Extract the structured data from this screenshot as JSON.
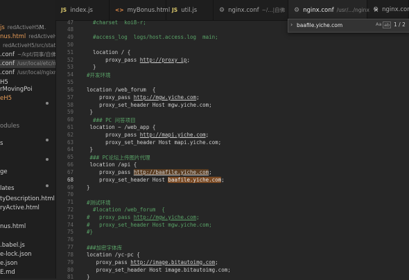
{
  "sidebar": {
    "items": [
      {
        "label": "js",
        "sub": "redActiveH5/...",
        "badge": "M",
        "style": "accent"
      },
      {
        "label": "nus.html",
        "sub": "redActiveH...",
        "style": "accent"
      },
      {
        "label": "",
        "sub": "redActiveH5/src/stati...",
        "style": ""
      },
      {
        "label": ".conf",
        "sub": "~/kpt/同事/自佛",
        "style": ""
      },
      {
        "label": ".conf",
        "sub": "/usr/local/etc/ngin",
        "style": "active"
      },
      {
        "label": ".conf",
        "sub": "/usr/local/ngixn/c...",
        "style": ""
      },
      {
        "label": "H5",
        "sub": "",
        "style": ""
      },
      {
        "label": "rMovingPoi",
        "sub": "",
        "style": ""
      },
      {
        "label": "eH5",
        "sub": "",
        "style": "accent"
      },
      {
        "label": "odules",
        "sub": "",
        "style": "section"
      },
      {
        "label": "s",
        "sub": "",
        "style": ""
      },
      {
        "label": "",
        "sub": "",
        "style": ""
      },
      {
        "label": "ge",
        "sub": "",
        "style": ""
      },
      {
        "label": "lates",
        "sub": "",
        "style": ""
      },
      {
        "label": "tyDescription.html",
        "sub": "",
        "style": ""
      },
      {
        "label": "ryActive.html",
        "sub": "",
        "style": ""
      },
      {
        "label": "",
        "sub": "",
        "style": ""
      },
      {
        "label": "nus.html",
        "sub": "",
        "style": ""
      },
      {
        "label": "",
        "sub": "",
        "style": ""
      },
      {
        "label": ".babel.js",
        "sub": "",
        "style": ""
      },
      {
        "label": "e-lock.json",
        "sub": "",
        "style": ""
      },
      {
        "label": "e.json",
        "sub": "",
        "style": ""
      },
      {
        "label": "E.md",
        "sub": "",
        "style": ""
      }
    ]
  },
  "tabs": [
    {
      "icon": "JS",
      "icon_class": "js",
      "label": "index.js",
      "dim": ""
    },
    {
      "icon": "<>",
      "icon_class": "html",
      "label": "myBonus.html",
      "dim": ""
    },
    {
      "icon": "JS",
      "icon_class": "js",
      "label": "util.js",
      "dim": ""
    },
    {
      "icon": "⚙",
      "icon_class": "gear",
      "label": "nginx.conf",
      "dim": "~/...|自佛"
    },
    {
      "icon": "⚙",
      "icon_class": "gear",
      "label": "nginx.conf",
      "dim": "/usr/.../nginx",
      "active": true
    },
    {
      "icon": "⚙",
      "icon_class": "gear",
      "label": "nginx.conf",
      "dim": ""
    }
  ],
  "find": {
    "query": "baafile.yiche.com",
    "opt_case": "Aa",
    "opt_word": "ab",
    "opt_regex": ".*",
    "count": "1 / 2"
  },
  "lines": [
    {
      "n": "47",
      "text": "    #charset  koi8-r;",
      "cls": "comment"
    },
    {
      "n": "48",
      "text": "",
      "cls": ""
    },
    {
      "n": "49",
      "text": "    #access_log  logs/host.access.log  main;",
      "cls": "comment"
    },
    {
      "n": "50",
      "text": "",
      "cls": ""
    },
    {
      "n": "51",
      "text": "    location / {",
      "cls": ""
    },
    {
      "n": "52",
      "pre": "        proxy_pass ",
      "url": "http://proxy_ip",
      "post": ";",
      "cls": ""
    },
    {
      "n": "53",
      "text": "    }",
      "cls": ""
    },
    {
      "n": "54",
      "text": "  #开发环境",
      "cls": "comment"
    },
    {
      "n": "55",
      "text": "",
      "cls": ""
    },
    {
      "n": "56",
      "text": "  location /web_forum  {",
      "cls": ""
    },
    {
      "n": "57",
      "pre": "      proxy_pass ",
      "url": "http://mgw.yiche.com",
      "post": ";",
      "cls": ""
    },
    {
      "n": "58",
      "text": "      proxy_set_header Host mgw.yiche.com;",
      "cls": ""
    },
    {
      "n": "59",
      "text": "   }",
      "cls": ""
    },
    {
      "n": "60",
      "text": "    ### PC 问答项目",
      "cls": "comment"
    },
    {
      "n": "61",
      "text": "   location ~ /web_app {",
      "cls": ""
    },
    {
      "n": "62",
      "pre": "        proxy_pass ",
      "url": "http://mapi.yiche.com",
      "post": ";",
      "cls": ""
    },
    {
      "n": "63",
      "text": "        proxy_set_header Host mapi.yiche.com;",
      "cls": ""
    },
    {
      "n": "64",
      "text": "   }",
      "cls": ""
    },
    {
      "n": "65",
      "text": "   ### PC论坛上传图片代理",
      "cls": "comment"
    },
    {
      "n": "66",
      "text": "   location /api {",
      "cls": ""
    },
    {
      "n": "67",
      "pre": "      proxy_pass ",
      "url": "http://baafile.yiche.com",
      "post": ";",
      "hl_url": true,
      "cls": ""
    },
    {
      "n": "68",
      "pre": "      proxy_set_header Host ",
      "hl": "baafile.yiche.com",
      "post": ";",
      "cls": "",
      "current": true
    },
    {
      "n": "69",
      "text": "  }",
      "cls": ""
    },
    {
      "n": "70",
      "text": "",
      "cls": ""
    },
    {
      "n": "71",
      "text": "  #测试环境",
      "cls": "comment"
    },
    {
      "n": "72",
      "text": "    #location /web_forum  {",
      "cls": "comment"
    },
    {
      "n": "73",
      "pre": "  #   proxy_pass ",
      "url": "http://mgw.yiche.com",
      "post": ";",
      "cls": "comment"
    },
    {
      "n": "74",
      "text": "  #   proxy_set_header Host mgw.yiche.com;",
      "cls": "comment"
    },
    {
      "n": "75",
      "text": "  #}",
      "cls": "comment"
    },
    {
      "n": "76",
      "text": "",
      "cls": ""
    },
    {
      "n": "77",
      "text": "  ###加密字体库",
      "cls": "comment"
    },
    {
      "n": "78",
      "text": "  location /yc-pc {",
      "cls": ""
    },
    {
      "n": "79",
      "pre": "     proxy_pass ",
      "url": "http://image.bitautoimg.com",
      "post": ";",
      "cls": ""
    },
    {
      "n": "80",
      "text": "     proxy_set_header Host image.bitautoimg.com;",
      "cls": ""
    },
    {
      "n": "81",
      "text": "  }",
      "cls": ""
    }
  ],
  "colors": {
    "background": "#262626",
    "comment": "#5aa468",
    "match_highlight": "#7a4a24",
    "accent": "#e59a56"
  }
}
